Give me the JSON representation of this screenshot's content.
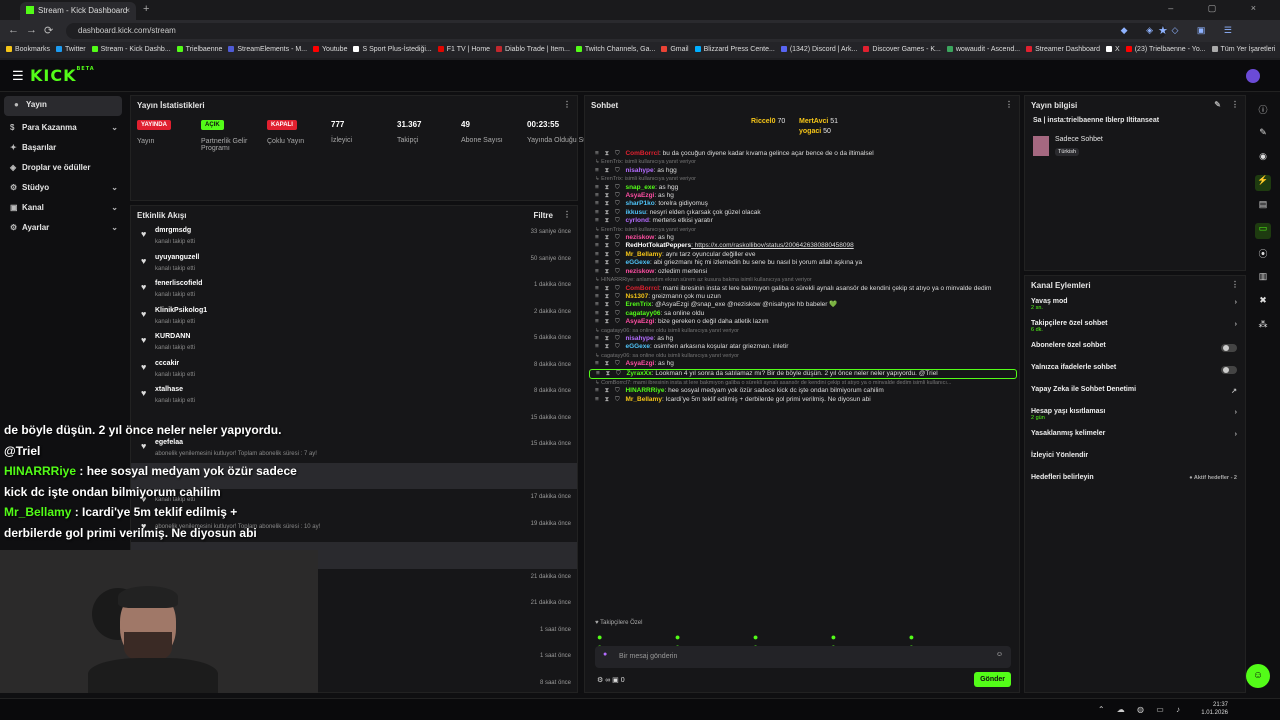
{
  "browser": {
    "tab_title": "Stream - Kick Dashboard",
    "url": "dashboard.kick.com/stream",
    "tab_close": "×",
    "new_tab": "+",
    "win_controls": "– ▢ ×",
    "nav_back": "←",
    "nav_fwd": "→",
    "nav_reload": "⟳",
    "star": "★",
    "ext": "◆ ◈ ◇ ▣ ☰",
    "bookmarks": [
      {
        "label": "Bookmarks",
        "color": "#f5c518"
      },
      {
        "label": "Twitter",
        "color": "#1d9bf0"
      },
      {
        "label": "Stream - Kick Dashb...",
        "color": "#53fc18"
      },
      {
        "label": "Trielbaenne",
        "color": "#53fc18"
      },
      {
        "label": "StreamElements - M...",
        "color": "#4f5bd5"
      },
      {
        "label": "Youtube",
        "color": "#ff0000"
      },
      {
        "label": "S Sport Plus-İstediği...",
        "color": "#ffffff"
      },
      {
        "label": "F1 TV | Home",
        "color": "#e10600"
      },
      {
        "label": "Diablo Trade | Item...",
        "color": "#c1272d"
      },
      {
        "label": "Twitch Channels, Ga...",
        "color": "#53fc18"
      },
      {
        "label": "Gmail",
        "color": "#ea4335"
      },
      {
        "label": "Blizzard Press Cente...",
        "color": "#00aeff"
      },
      {
        "label": "(1342) Discord | Ark...",
        "color": "#5865f2"
      },
      {
        "label": "Discover Games - K...",
        "color": "#e0202f"
      },
      {
        "label": "wowaudit - Ascend...",
        "color": "#3ba55d"
      },
      {
        "label": "Streamer Dashboard",
        "color": "#e0202f"
      },
      {
        "label": "X",
        "color": "#ffffff"
      },
      {
        "label": "(23) Trielbaenne - Yo...",
        "color": "#ff0000"
      },
      {
        "label": "Tüm Yer İşaretleri",
        "color": "#aaaaaa"
      }
    ]
  },
  "header": {
    "logo": "KICK",
    "beta": "BETA"
  },
  "sidebar": {
    "items": [
      {
        "label": "Yayın",
        "icon": "●",
        "chevron": ""
      },
      {
        "label": "Para Kazanma",
        "icon": "$",
        "chevron": "⌄"
      },
      {
        "label": "Başarılar",
        "icon": "✦",
        "chevron": ""
      },
      {
        "label": "Droplar ve ödüller",
        "icon": "◈",
        "chevron": ""
      },
      {
        "label": "Stüdyo",
        "icon": "⚙",
        "chevron": "⌄"
      },
      {
        "label": "Kanal",
        "icon": "▣",
        "chevron": "⌄"
      },
      {
        "label": "Ayarlar",
        "icon": "⚙",
        "chevron": "⌄"
      }
    ]
  },
  "stats": {
    "title": "Yayın İstatistikleri",
    "more": "⋮",
    "items": [
      {
        "badge": "YAYINDA",
        "label": "Yayın"
      },
      {
        "badge": "AÇIK",
        "label": "Partnerlik Gelir Programı"
      },
      {
        "badge": "KAPALI",
        "label": "Çoklu Yayın"
      },
      {
        "value": "777",
        "label": "İzleyici"
      },
      {
        "value": "31.367",
        "label": "Takipçi"
      },
      {
        "value": "49",
        "label": "Abone Sayısı"
      },
      {
        "value": "00:23:55",
        "label": "Yayında Olduğu Süre"
      }
    ]
  },
  "activity": {
    "title": "Etkinlik Akışı",
    "filter": "Filtre",
    "more": "⋮",
    "rows": [
      {
        "name": "dmrgmsdg",
        "sub": "kanalı takip etti",
        "time": "33 saniye önce"
      },
      {
        "name": "uyuyanguzell",
        "sub": "kanalı takip etti",
        "time": "50 saniye önce"
      },
      {
        "name": "fenerliscofield",
        "sub": "kanalı takip etti",
        "time": "1 dakika önce"
      },
      {
        "name": "KlinikPsikolog1",
        "sub": "kanalı takip etti",
        "time": "2 dakika önce"
      },
      {
        "name": "KURDANN",
        "sub": "kanalı takip etti",
        "time": "5 dakika önce"
      },
      {
        "name": "cccakir",
        "sub": "kanalı takip etti",
        "time": "8 dakika önce"
      },
      {
        "name": "xtalhase",
        "sub": "kanalı takip etti",
        "time": "8 dakika önce"
      },
      {
        "name": "",
        "sub": "",
        "time": "15 dakika önce"
      },
      {
        "name": "egefelaa",
        "sub": "abonelik yenilemesini kutluyor! Toplam abonelik süresi : 7 ay!",
        "time": "15 dakika önce"
      },
      {
        "name": "",
        "sub": "",
        "time": ""
      },
      {
        "name": "",
        "sub": "kanalı takip etti",
        "time": "17 dakika önce"
      },
      {
        "name": "",
        "sub": "abonelik yenilemesini kutluyor! Toplam abonelik süresi : 10 ay!",
        "time": "19 dakika önce"
      },
      {
        "name": "",
        "sub": "",
        "time": ""
      },
      {
        "name": "",
        "sub": "",
        "time": "21 dakika önce"
      },
      {
        "name": "",
        "sub": "",
        "time": "21 dakika önce"
      },
      {
        "name": "",
        "sub": "",
        "time": "1 saat önce"
      },
      {
        "name": "",
        "sub": "",
        "time": "1 saat önce"
      },
      {
        "name": "",
        "sub": "",
        "time": "8 saat önce"
      }
    ]
  },
  "overlay": {
    "line1": "de böyle düşün. 2 yıl önce neler neler yapıyordu.",
    "line2": "@Triel",
    "u2": "HINARRRiye",
    "t2": ": hee sosyal medyam yok özür sadece",
    "t2b": "kick dc işte ondan bilmiyorum cahilim",
    "u3": "Mr_Bellamy",
    "t3": ": Icardi'ye 5m teklif edilmiş +",
    "t3b": "derbilerde gol primi verilmiş. Ne diyosun abi"
  },
  "chat": {
    "title": "Sohbet",
    "more": "⋮",
    "top": [
      {
        "name": "Riccel0",
        "count": "70"
      },
      {
        "name": "MertAvci",
        "count": "51"
      },
      {
        "name": "yogaci",
        "count": "50"
      }
    ],
    "messages": [
      {
        "reply": false,
        "user": "ComBorrcl",
        "color": "#e0202f",
        "text": ": bu da çocuğun diyene kadar kıvama gelince açar bence de o da iltimalsel"
      },
      {
        "reply": true,
        "text": "↳ ErenTrix: isimli kullanıcıya yanıt veriyor"
      },
      {
        "reply": false,
        "user": "nisahype",
        "color": "#b46cff",
        "text": ": as hgg"
      },
      {
        "reply": true,
        "text": "↳ ErenTrix: isimli kullanıcıya yanıt veriyor"
      },
      {
        "reply": false,
        "user": "snap_exe",
        "color": "#53fc18",
        "text": ": as hgg"
      },
      {
        "reply": false,
        "user": "AsyaEzgi",
        "color": "#ff4fa3",
        "text": ": as hg"
      },
      {
        "reply": false,
        "user": "sharP1ko",
        "color": "#4fc3f7",
        "text": ": torelra gidiyomuş"
      },
      {
        "reply": false,
        "user": "ikkusu",
        "color": "#4fc3f7",
        "text": ": nesyri elden çıkarsak çok güzel olacak"
      },
      {
        "reply": false,
        "user": "cyrlond",
        "color": "#b46cff",
        "text": ": mertens etkisi yaratır"
      },
      {
        "reply": true,
        "text": "↳ ErenTrix: isimli kullanıcıya yanıt veriyor"
      },
      {
        "reply": false,
        "user": "neziskow",
        "color": "#ff4fa3",
        "text": ": as hg"
      },
      {
        "reply": false,
        "user": "RedHotTokatPeppers",
        "color": "#ffffff",
        "text": ": https://x.com/raskollibov/status/2006426380880458098",
        "link": true
      },
      {
        "reply": false,
        "user": "Mr_Bellamy",
        "color": "#f5c518",
        "text": ": aynı tarz oyuncular değiller eve"
      },
      {
        "reply": false,
        "user": "eGGexe",
        "color": "#4fc3f7",
        "text": ": abi griezmanı hiç mi izlemedin bu sene bu nasıl bi yorum allah aşkına ya"
      },
      {
        "reply": false,
        "user": "neziskow",
        "color": "#ff4fa3",
        "text": ": ozledim mertensi"
      },
      {
        "reply": true,
        "text": "↳ HINARRRiye: anlamadım ekran sürem az kusura bakma isimli kullanıcıya yanıt veriyor"
      },
      {
        "reply": false,
        "user": "ComBorrcl",
        "color": "#e0202f",
        "text": ": mami ibresinin insta st lere bakmıyon galiba o sürekli aynalı asansör de kendini çekip st atıyo ya o minvalde dedim"
      },
      {
        "reply": false,
        "user": "Ns1307",
        "color": "#f5c518",
        "text": ": greizmann çok mu uzun"
      },
      {
        "reply": false,
        "user": "ErenTrix",
        "color": "#53fc18",
        "text": ": @AsyaEzgi @snap_exe @neziskow @nisahype hb babeler 💚"
      },
      {
        "reply": false,
        "user": "cagatayy06",
        "color": "#53fc18",
        "text": ": sa online oldu"
      },
      {
        "reply": false,
        "user": "AsyaEzgi",
        "color": "#ff4fa3",
        "text": ": bize gereken o değil daha atletik lazım"
      },
      {
        "reply": true,
        "text": "↳ cagatayy06: sa online oldu isimli kullanıcıya yanıt veriyor"
      },
      {
        "reply": false,
        "user": "nisahype",
        "color": "#b46cff",
        "text": ": as hg"
      },
      {
        "reply": false,
        "user": "eGGexe",
        "color": "#4fc3f7",
        "text": ": osimhen arkasına koşular atar griezman. inletir"
      },
      {
        "reply": true,
        "text": "↳ cagatayy06: sa online oldu isimli kullanıcıya yanıt veriyor"
      },
      {
        "reply": false,
        "user": "AsyaEzgi",
        "color": "#ff4fa3",
        "text": ": as hg"
      },
      {
        "reply": false,
        "user": "ZyraxXx",
        "color": "#53fc18",
        "text": ": Lookman 4 yıl sonra da satılamaz mı? Bir de böyle düşün. 2 yıl önce neler neler yapıyordu. @Triel",
        "focus": true
      },
      {
        "reply": true,
        "text": "↳ ComBorrcl7: mami ibresinin insta st lere bakmıyon galiba o sürekli aynalı asansör de kendini çekip st atıyo ya o minvalde dedim isimli kullanıcı..."
      },
      {
        "reply": false,
        "user": "HINARRRiye",
        "color": "#53fc18",
        "text": ": hee sosyal medyam yok özür sadece kick dc işte ondan bilmiyorum cahilim"
      },
      {
        "reply": false,
        "user": "Mr_Bellamy",
        "color": "#f5c518",
        "text": ": Icardi'ye 5m teklif edilmiş + derbilerde gol primi verilmiş. Ne diyosun abi"
      }
    ],
    "follower_only": "♥ Takipçilere Özel",
    "input_placeholder": "Bir mesaj gönderin",
    "send": "Gönder",
    "footer_count": "0"
  },
  "info": {
    "title": "Yayın bilgisi",
    "stream_title": "Sa | insta:trielbaenne Iblerp Iltitanseat",
    "category": "Sadece Sohbet",
    "language": "Türkish"
  },
  "channel": {
    "title": "Kanal Eylemleri",
    "rows": [
      {
        "label": "Yavaş mod",
        "sub": "2 sn.",
        "control": "chev"
      },
      {
        "label": "Takipçilere özel sohbet",
        "sub": "6 dk.",
        "control": "chev"
      },
      {
        "label": "Abonelere özel sohbet",
        "sub": "",
        "control": "toggle"
      },
      {
        "label": "Yalnızca ifadelerle sohbet",
        "sub": "",
        "control": "toggle"
      },
      {
        "label": "Yapay Zeka ile Sohbet Denetimi",
        "sub": "",
        "control": "ext"
      },
      {
        "label": "Hesap yaşı kısıtlaması",
        "sub": "2 gün",
        "control": "chev"
      },
      {
        "label": "Yasaklanmış kelimeler",
        "sub": "",
        "control": "chev"
      },
      {
        "label": "İzleyici Yönlendir",
        "sub": "",
        "control": ""
      },
      {
        "label": "Hedefleri belirleyin",
        "sub": "",
        "control": "goal"
      }
    ],
    "goal_text": "● Aktif hedefler - 2"
  },
  "taskbar": {
    "time": "21:37",
    "date": "1.01.2026"
  }
}
